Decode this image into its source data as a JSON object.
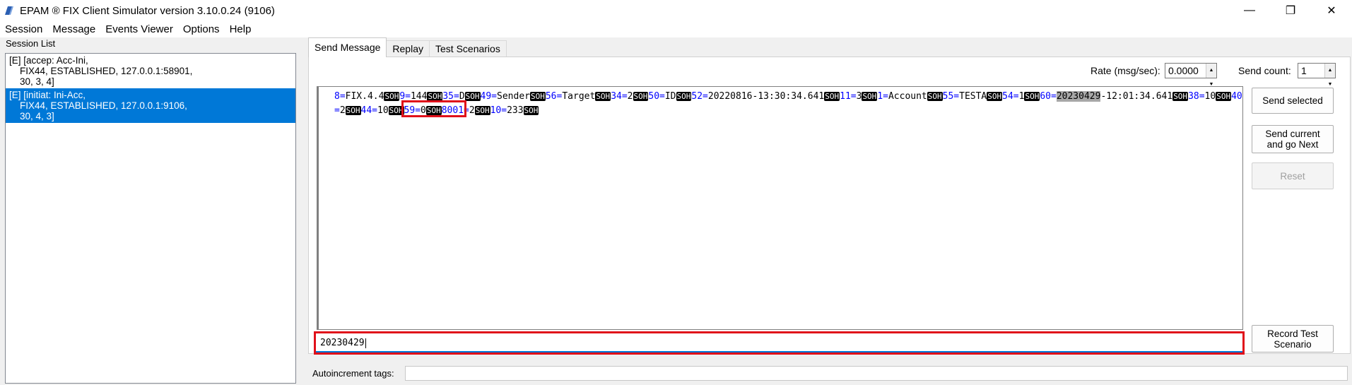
{
  "window": {
    "title": "EPAM ® FIX Client Simulator version 3.10.0.24 (9106)",
    "controls": {
      "minimize": "—",
      "maximize": "❐",
      "close": "✕"
    }
  },
  "menu": [
    "Session",
    "Message",
    "Events Viewer",
    "Options",
    "Help"
  ],
  "session_list": {
    "label": "Session List",
    "items": [
      {
        "lines": [
          "[E] [accep: Acc-Ini,",
          "    FIX44, ESTABLISHED, 127.0.0.1:58901,",
          "    30, 3, 4]"
        ],
        "selected": false
      },
      {
        "lines": [
          "[E] [initiat: Ini-Acc,",
          "    FIX44, ESTABLISHED, 127.0.0.1:9106,",
          "    30, 4, 3]"
        ],
        "selected": true
      }
    ]
  },
  "tabs": [
    {
      "label": "Send Message",
      "active": true
    },
    {
      "label": "Replay",
      "active": false
    },
    {
      "label": "Test Scenarios",
      "active": false
    }
  ],
  "rate": {
    "label": "Rate (msg/sec):",
    "value": "0.0000"
  },
  "send_count": {
    "label": "Send count:",
    "value": "1"
  },
  "message_fields": [
    {
      "tag": "8",
      "value": "FIX.4.4"
    },
    {
      "tag": "9",
      "value": "144"
    },
    {
      "tag": "35",
      "value": "D"
    },
    {
      "tag": "49",
      "value": "Sender"
    },
    {
      "tag": "56",
      "value": "Target"
    },
    {
      "tag": "34",
      "value": "2"
    },
    {
      "tag": "50",
      "value": "ID"
    },
    {
      "tag": "52",
      "value": "20220816-13:30:34.641"
    },
    {
      "tag": "11",
      "value": "3"
    },
    {
      "tag": "1",
      "value": "Account"
    },
    {
      "tag": "55",
      "value": "TESTA"
    },
    {
      "tag": "54",
      "value": "1"
    },
    {
      "tag": "60",
      "value": "20230429-12:01:34.641",
      "highlight": "20230429"
    },
    {
      "tag": "38",
      "value": "10"
    },
    {
      "tag": "40",
      "value": "2"
    },
    {
      "tag": "44",
      "value": "10"
    },
    {
      "tag": "59",
      "value": "0"
    },
    {
      "tag": "8001",
      "value": "2"
    },
    {
      "tag": "10",
      "value": "233"
    }
  ],
  "soh_label": "SOH",
  "buttons": {
    "send_selected": "Send selected",
    "send_current_next": "Send current and go Next",
    "reset": "Reset",
    "record_test": "Record Test Scenario"
  },
  "value_input": {
    "value": "20230429"
  },
  "autoincrement": {
    "label": "Autoincrement tags:",
    "value": ""
  }
}
